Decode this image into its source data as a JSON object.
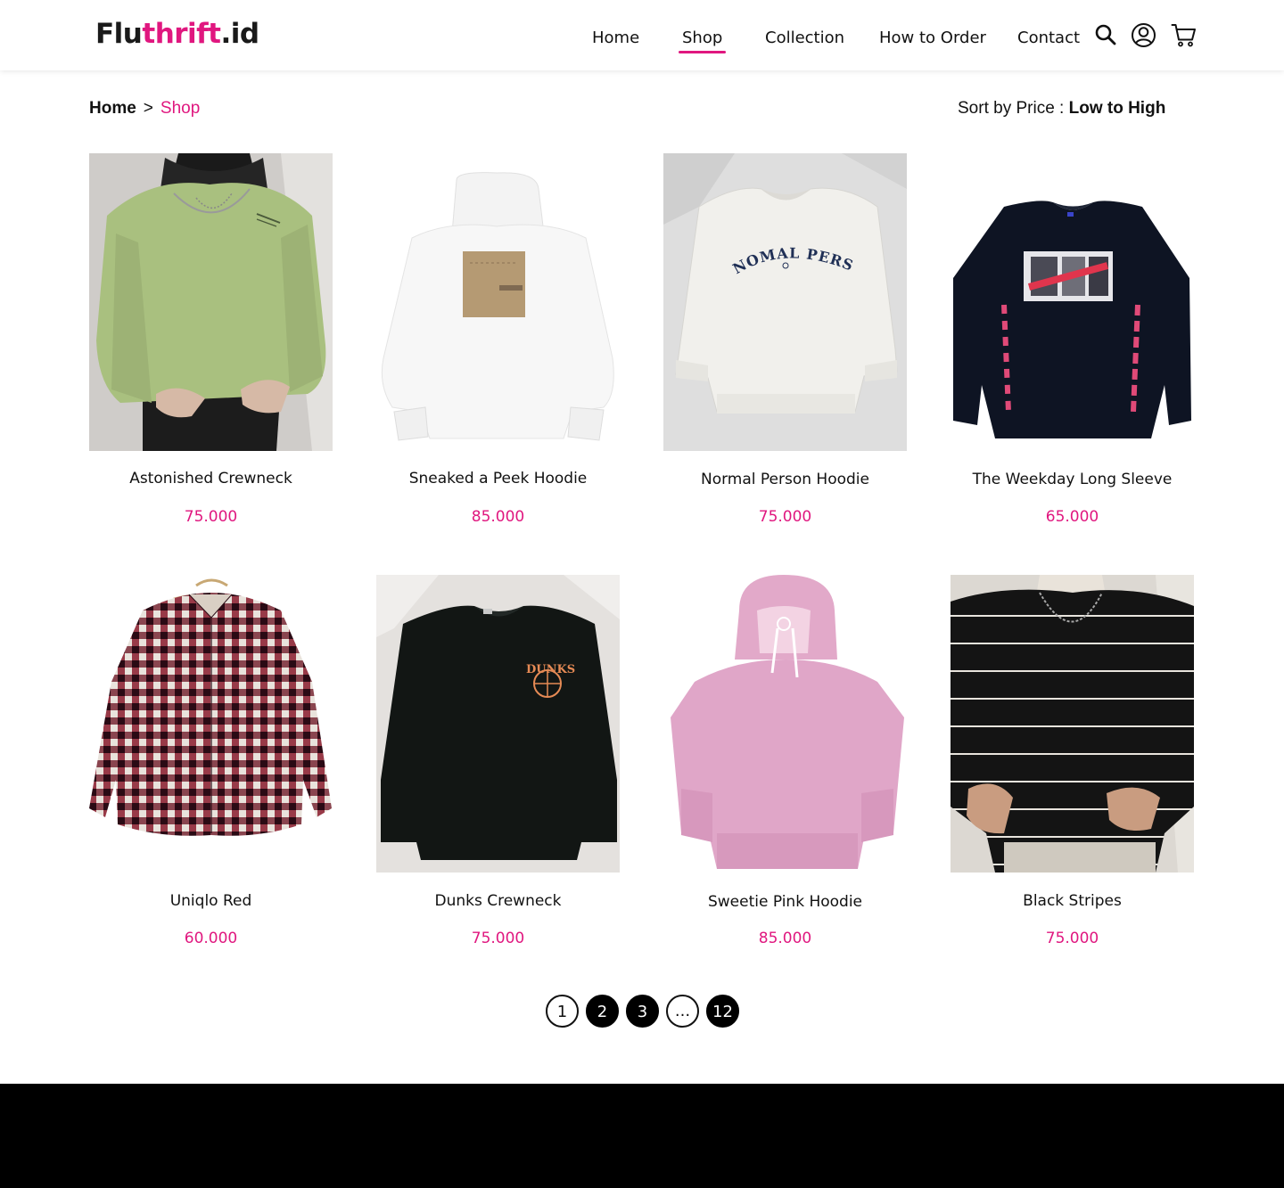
{
  "brand": {
    "logo_prefix": "Flu",
    "logo_accent": "thrift",
    "logo_suffix": ".id",
    "accent_color": "#e0177f"
  },
  "nav": {
    "items": [
      {
        "label": "Home"
      },
      {
        "label": "Shop",
        "active": true
      },
      {
        "label": "Collection"
      },
      {
        "label": "How to Order"
      },
      {
        "label": "Contact"
      }
    ],
    "icons": [
      "search-icon",
      "account-icon",
      "cart-icon"
    ]
  },
  "breadcrumb": {
    "home": "Home",
    "separator": ">",
    "current": "Shop"
  },
  "sort": {
    "label": "Sort by Price :",
    "value": "Low to High"
  },
  "products": [
    {
      "name": "Astonished Crewneck",
      "price": "75.000"
    },
    {
      "name": "Sneaked a Peek Hoodie",
      "price": "85.000"
    },
    {
      "name": "Normal Person Hoodie",
      "price": "75.000"
    },
    {
      "name": "The Weekday Long Sleeve",
      "price": "65.000"
    },
    {
      "name": "Uniqlo Red",
      "price": "60.000"
    },
    {
      "name": "Dunks Crewneck",
      "price": "75.000"
    },
    {
      "name": "Sweetie Pink Hoodie",
      "price": "85.000"
    },
    {
      "name": "Black Stripes",
      "price": "75.000"
    }
  ],
  "product_images": {
    "normal_person_print": "NOMAL PERSON",
    "dunks_print": "DUNKS"
  },
  "pagination": {
    "pages": [
      "1",
      "2",
      "3",
      "...",
      "12"
    ],
    "current": "1"
  }
}
